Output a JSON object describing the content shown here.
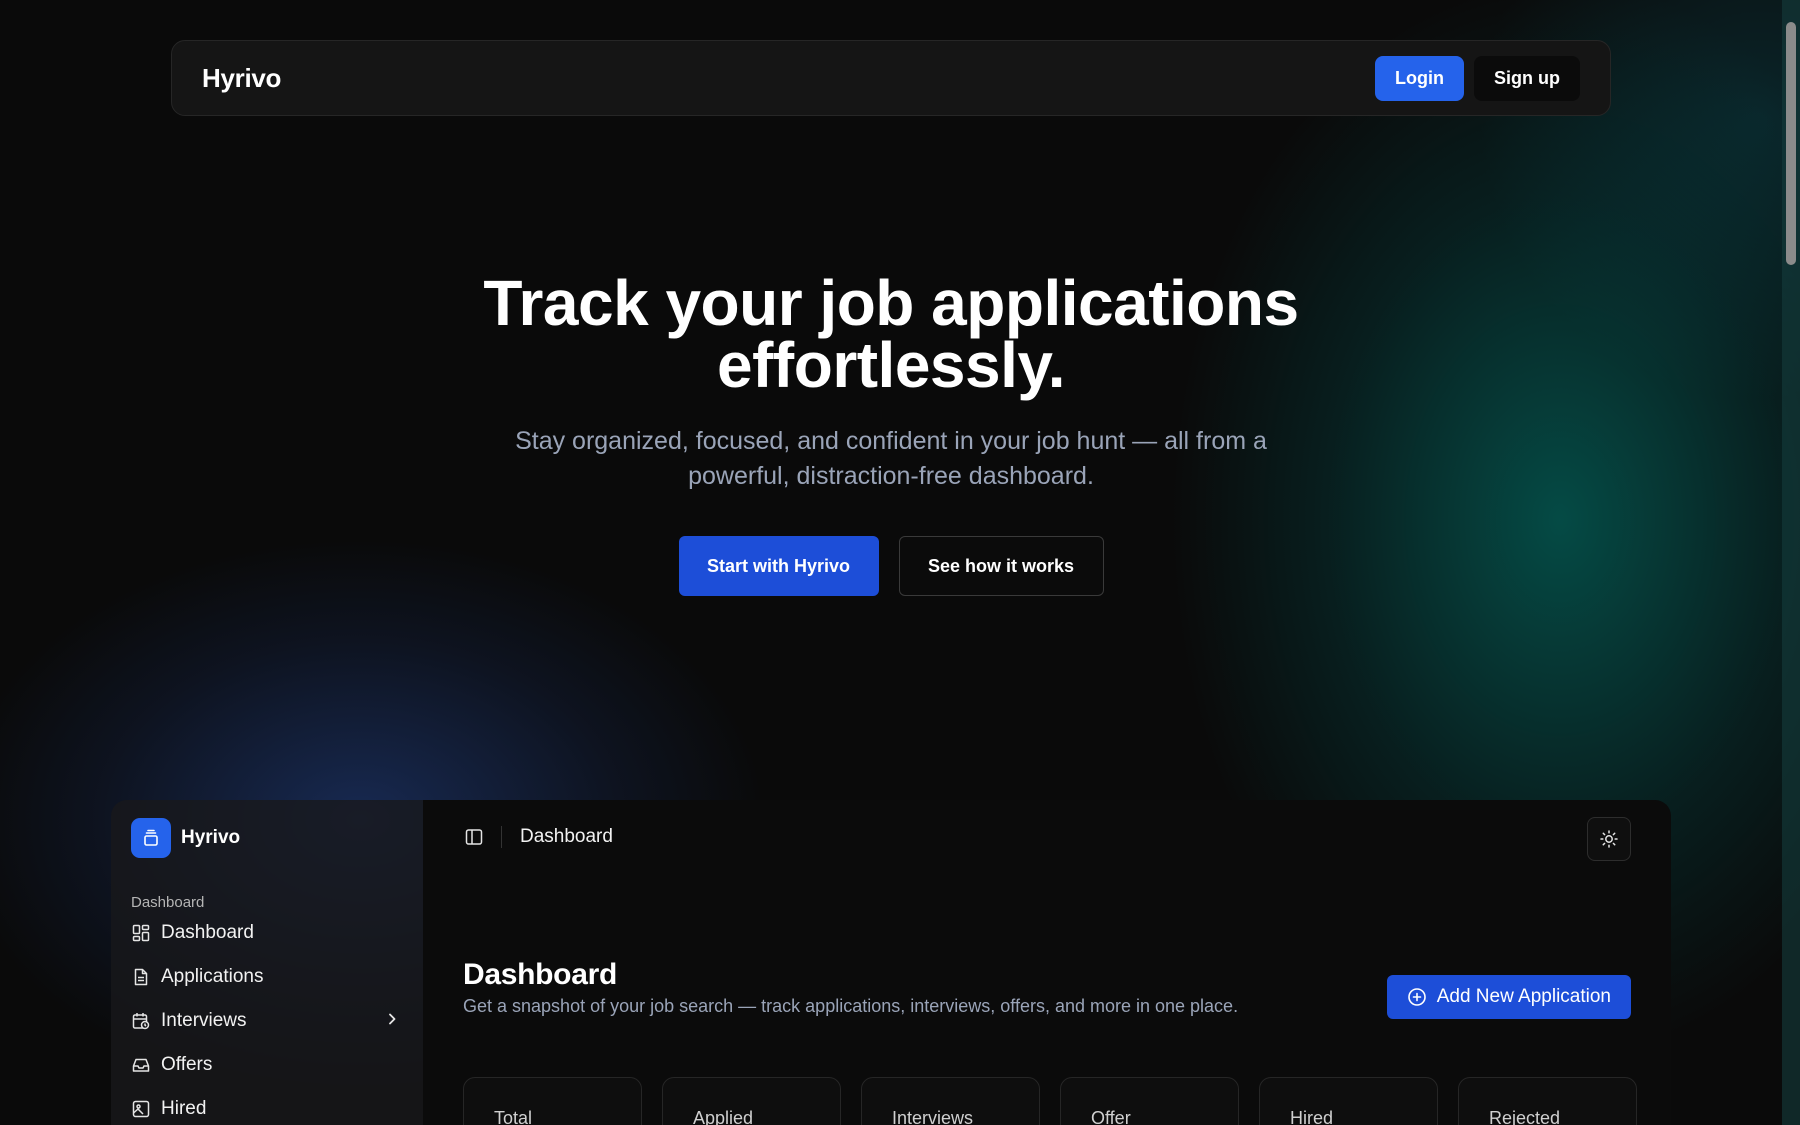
{
  "nav": {
    "brand": "Hyrivo",
    "login_label": "Login",
    "signup_label": "Sign up"
  },
  "hero": {
    "title_line1": "Track your job applications",
    "title_line2": "effortlessly.",
    "subtitle": "Stay organized, focused, and confident in your job hunt — all from a powerful, distraction-free dashboard.",
    "primary_cta": "Start with Hyrivo",
    "secondary_cta": "See how it works"
  },
  "preview": {
    "sidebar": {
      "brand": "Hyrivo",
      "group_label": "Dashboard",
      "items": [
        {
          "label": "Dashboard",
          "icon": "dashboard-icon"
        },
        {
          "label": "Applications",
          "icon": "file-text-icon"
        },
        {
          "label": "Interviews",
          "icon": "calendar-clock-icon",
          "has_submenu": true
        },
        {
          "label": "Offers",
          "icon": "inbox-icon"
        },
        {
          "label": "Hired",
          "icon": "image-icon"
        }
      ]
    },
    "breadcrumb": "Dashboard",
    "page_title": "Dashboard",
    "page_subtitle": "Get a snapshot of your job search — track applications, interviews, offers, and more in one place.",
    "add_button": "Add New Application",
    "stats": [
      "Total",
      "Applied",
      "Interviews",
      "Offer",
      "Hired",
      "Rejected"
    ]
  },
  "colors": {
    "accent": "#2563eb",
    "accent_dark": "#1d4ed8",
    "background": "#0a0a0a",
    "muted_text": "#9aa4b8"
  }
}
